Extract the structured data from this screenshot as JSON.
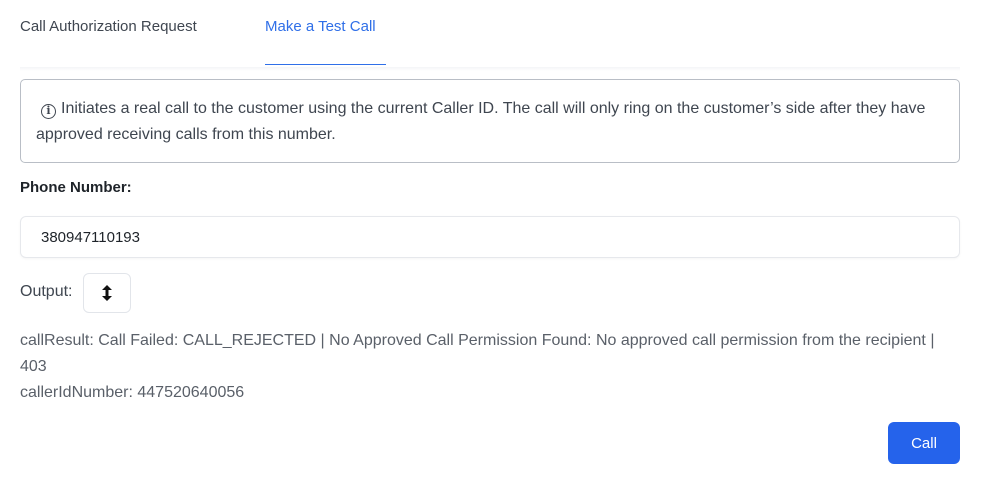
{
  "tabs": [
    {
      "label": "Call Authorization Request",
      "active": false
    },
    {
      "label": "Make a Test Call",
      "active": true
    }
  ],
  "info": {
    "icon": "info-icon",
    "text": "Initiates a real call to the customer using the current Caller ID. The call will only ring on the customer’s side after they have approved receiving calls from this number."
  },
  "phone": {
    "label": "Phone Number:",
    "value": "380947110193"
  },
  "output": {
    "label": "Output:",
    "toggle_icon": "vertical-resize-icon",
    "lines": [
      "callResult: Call Failed: CALL_REJECTED | No Approved Call Permission Found: No approved call permission from the recipient | 403",
      "callerIdNumber: 447520640056"
    ]
  },
  "actions": {
    "call_label": "Call"
  },
  "colors": {
    "accent": "#2f6fe8",
    "button": "#2563eb",
    "text": "#3f4650"
  }
}
